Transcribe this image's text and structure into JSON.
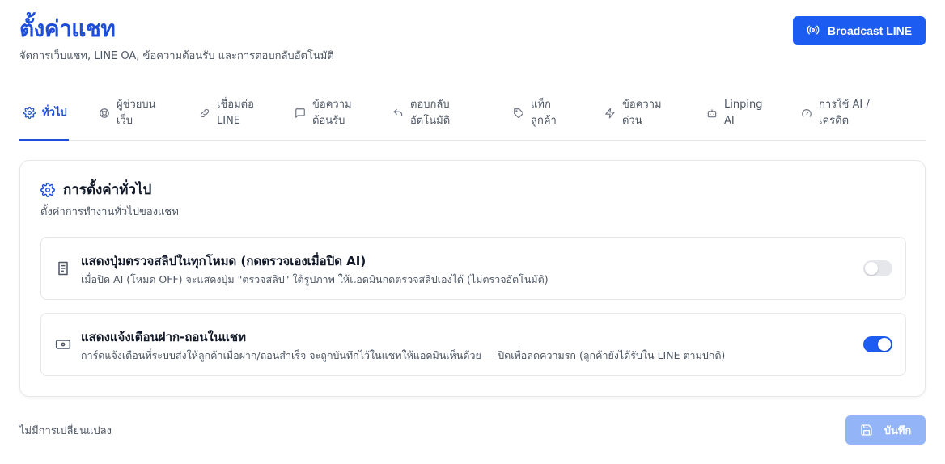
{
  "header": {
    "title": "ตั้งค่าแชท",
    "subtitle": "จัดการเว็บแชท, LINE OA, ข้อความต้อนรับ และการตอบกลับอัตโนมัติ",
    "broadcast_label": "Broadcast LINE",
    "broadcast_icon": "radio-broadcast-icon"
  },
  "tabs": [
    {
      "label": "ทั่วไป",
      "icon": "gear-icon",
      "active": true
    },
    {
      "label": "ผู้ช่วยบน เว็บ",
      "icon": "lifebuoy-icon",
      "active": false
    },
    {
      "label": "เชื่อมต่อ LINE",
      "icon": "link-icon",
      "active": false
    },
    {
      "label": "ข้อความ ต้อนรับ",
      "icon": "message-icon",
      "active": false
    },
    {
      "label": "ตอบกลับ อัตโนมัติ",
      "icon": "reply-icon",
      "active": false
    },
    {
      "label": "แท็ก ลูกค้า",
      "icon": "tag-icon",
      "active": false
    },
    {
      "label": "ข้อความ ด่วน",
      "icon": "lightning-icon",
      "active": false
    },
    {
      "label": "Linping AI",
      "icon": "bot-icon",
      "active": false
    },
    {
      "label": "การใช้ AI / เครดิต",
      "icon": "gauge-icon",
      "active": false
    }
  ],
  "card": {
    "title": "การตั้งค่าทั่วไป",
    "description": "ตั้งค่าการทำงานทั่วไปของแชท",
    "settings": [
      {
        "title": "แสดงปุ่มตรวจสลิปในทุกโหมด (กดตรวจเองเมื่อปิด AI)",
        "description": "เมื่อปิด AI (โหมด OFF) จะแสดงปุ่ม \"ตรวจสลิป\" ใต้รูปภาพ ให้แอดมินกดตรวจสลิปเองได้ (ไม่ตรวจอัตโนมัติ)",
        "icon": "receipt-icon",
        "enabled": false
      },
      {
        "title": "แสดงแจ้งเตือนฝาก-ถอนในแชท",
        "description": "การ์ดแจ้งเตือนที่ระบบส่งให้ลูกค้าเมื่อฝาก/ถอนสำเร็จ จะถูกบันทึกไว้ในแชทให้แอดมินเห็นด้วย — ปิดเพื่อลดความรก (ลูกค้ายังได้รับใน LINE ตามปกติ)",
        "icon": "banknote-icon",
        "enabled": true
      }
    ]
  },
  "footer": {
    "status": "ไม่มีการเปลี่ยนแปลง",
    "save_label": "บันทึก",
    "save_icon": "floppy-disk-icon"
  },
  "colors": {
    "primary": "#1d5cf0",
    "title_blue": "#1d4ed8",
    "save_disabled": "#93b4f7"
  }
}
